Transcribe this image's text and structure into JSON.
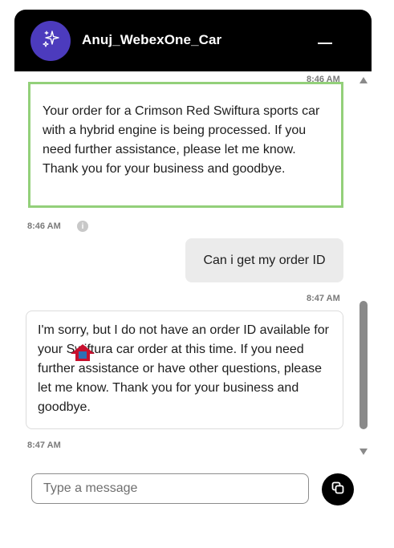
{
  "header": {
    "title": "Anuj_WebexOne_Car",
    "avatar_icon": "sparkle-icon",
    "minimize_icon": "minimize-icon",
    "background": "#000000",
    "avatar_color": "#4c3bbd"
  },
  "messages": [
    {
      "sender": "bot",
      "time": "8:46 AM",
      "text": "Your order for a Crimson Red Swiftura sports car with a hybrid engine is being processed. If you need further assistance, please let me know. Thank you for your business and goodbye.",
      "highlighted": true,
      "highlight_color": "#93d07a",
      "footer_time": "8:46 AM"
    },
    {
      "sender": "user",
      "text": "Can i get my order ID",
      "time": "8:47 AM"
    },
    {
      "sender": "bot",
      "text": "I'm sorry, but I do not have an order ID available for your Swiftura car order at this time. If you need further assistance or have other questions, please let me know. Thank you for your business and goodbye.",
      "footer_time": "8:47 AM"
    }
  ],
  "composer": {
    "placeholder": "Type a message",
    "send_icon": "send-icon"
  }
}
